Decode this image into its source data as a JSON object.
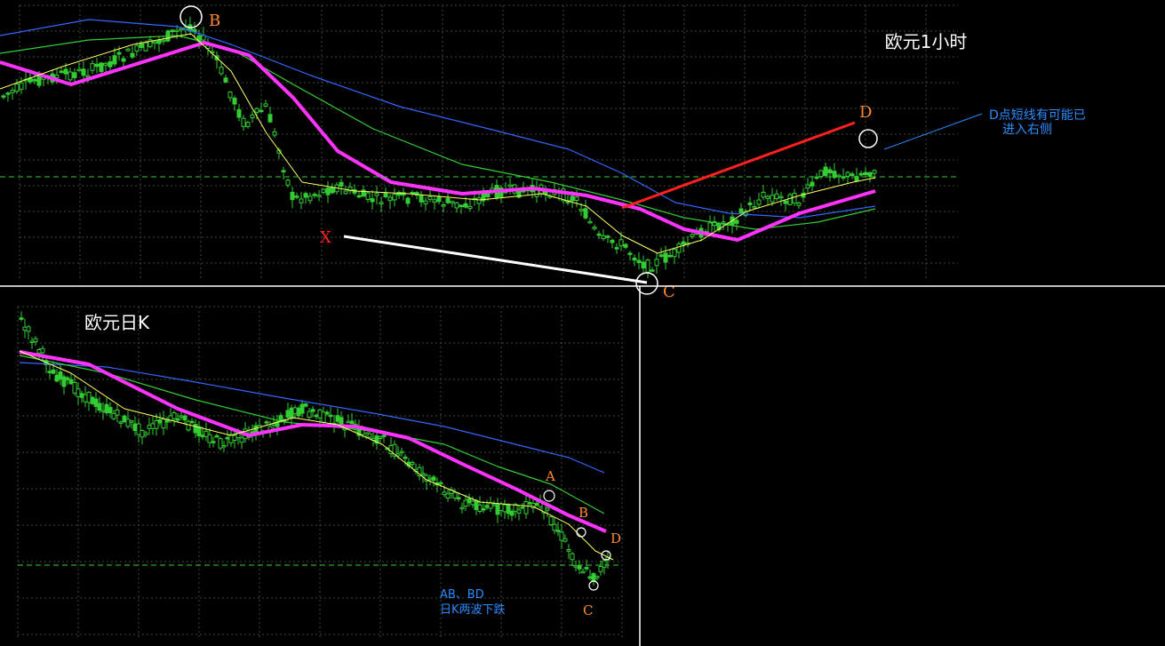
{
  "colors": {
    "background": "#000000",
    "grid": "#3a4a3a",
    "candle": "#33cc33",
    "ma_fast": "#ffff66",
    "ma_mid": "#ff33ff",
    "ma_slow1": "#33cc33",
    "ma_slow2": "#3366ff",
    "support": "#33cc33",
    "line_xc": "#ffffff",
    "line_cd": "#ff2020",
    "point_label": "#ff8833",
    "x_label": "#ff2020",
    "note": "#2a8cff"
  },
  "top_panel": {
    "title": "欧元1小时",
    "labels": {
      "B": "B",
      "X": "X",
      "C": "C",
      "D": "D"
    },
    "note_line1": "D点短线有可能已",
    "note_line2": "进入右侧"
  },
  "bottom_panel": {
    "title": "欧元日K",
    "labels": {
      "A": "A",
      "B": "B",
      "C": "C",
      "D": "D"
    },
    "note_line1": "AB、BD",
    "note_line2": "日K两波下跌"
  },
  "chart_data": [
    {
      "type": "candlestick",
      "title": "欧元1小时",
      "annotations": [
        "B",
        "X",
        "C",
        "D",
        "D点短线有可能已进入右侧"
      ],
      "grid": true,
      "trend": "decline from B to C, then rebound toward D"
    },
    {
      "type": "candlestick",
      "title": "欧元日K",
      "annotations": [
        "A",
        "B",
        "C",
        "D",
        "AB、BD 日K两波下跌"
      ],
      "grid": true,
      "trend": "two-wave decline"
    }
  ]
}
